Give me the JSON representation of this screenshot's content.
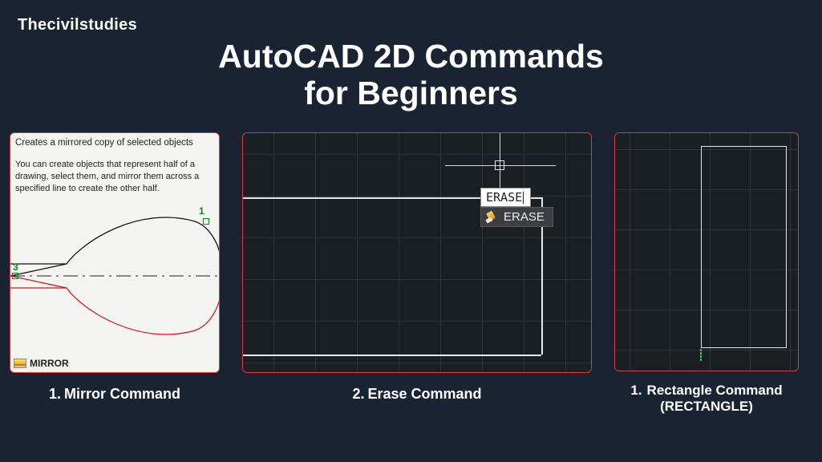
{
  "brand": "Thecivilstudies",
  "title_line1": "AutoCAD 2D Commands",
  "title_line2": "for Beginners",
  "panels": {
    "mirror": {
      "tooltip_title": "Creates a mirrored copy of selected objects",
      "tooltip_body": "You can create objects that represent half of a drawing, select them, and mirror them across a specified line to create the other half.",
      "footer_label": "MIRROR",
      "pt1": "1",
      "pt3": "3",
      "caption_num": "1.",
      "caption_text": "Mirror Command"
    },
    "erase": {
      "typed": "ERASE",
      "dropdown": "ERASE",
      "caption_num": "2.",
      "caption_text": "Erase Command"
    },
    "rect": {
      "caption_num": "1.",
      "caption_line1": "Rectangle Command",
      "caption_line2": "(RECTANGLE)"
    }
  }
}
